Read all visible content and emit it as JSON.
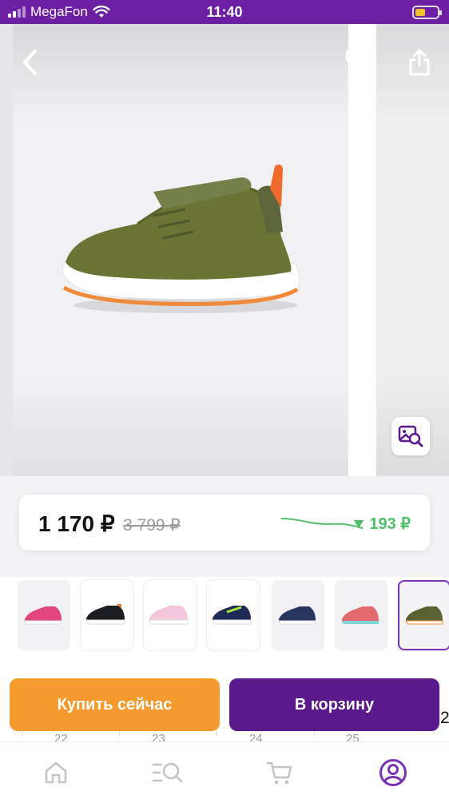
{
  "status_bar": {
    "carrier": "MegaFon",
    "time": "11:40"
  },
  "gallery": {
    "back_icon": "chevron-left-icon",
    "favorite_icon": "heart-icon",
    "share_icon": "share-icon",
    "image_search_icon": "image-search-icon"
  },
  "price": {
    "current": "1 170 ₽",
    "old": "3 799 ₽",
    "drop": "193 ₽",
    "drop_color": "#4cbf6b"
  },
  "color_options": [
    {
      "name": "pink",
      "color": "#e0457b"
    },
    {
      "name": "black-orange",
      "color": "#1d1d24"
    },
    {
      "name": "light-pink",
      "color": "#f3c6dc"
    },
    {
      "name": "navy-lime",
      "color": "#1f2a55"
    },
    {
      "name": "navy-teal",
      "color": "#27365f"
    },
    {
      "name": "coral",
      "color": "#e56a6d"
    },
    {
      "name": "olive",
      "color": "#5a6130",
      "selected": true
    }
  ],
  "actions": {
    "buy_now": "Купить сейчас",
    "add_to_cart": "В корзину",
    "accent_buy": "#f59a2c",
    "accent_cart": "#5b1a8c"
  },
  "dates": [
    "22",
    "23",
    "24",
    "25"
  ],
  "edge_digit": "2",
  "tab_bar": [
    "home-icon",
    "catalog-search-icon",
    "cart-icon",
    "profile-icon"
  ]
}
